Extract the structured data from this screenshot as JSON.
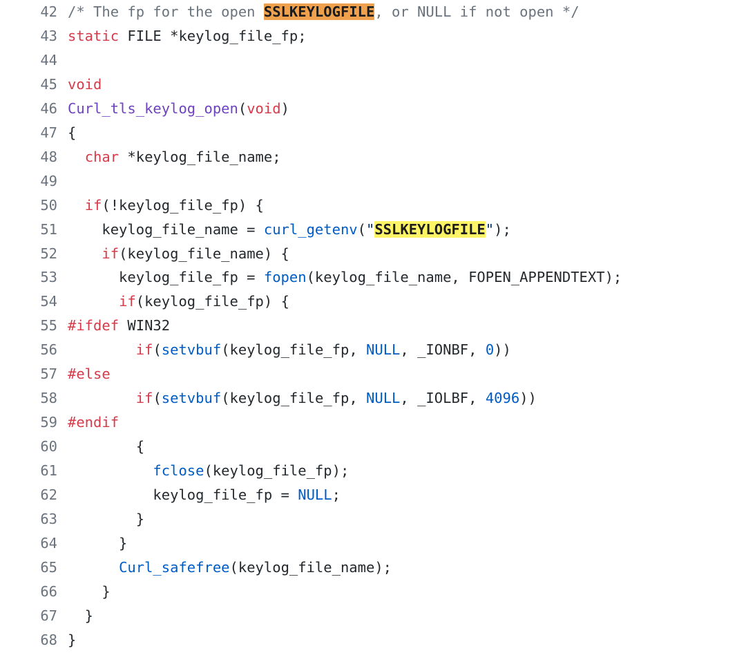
{
  "viewer": {
    "language": "C",
    "background_color": "#ffffff",
    "gutter_color": "#6a737d",
    "text_color": "#24292e",
    "first_line_number": 42,
    "last_line_number": 68,
    "total_lines_shown": 27
  },
  "theme": {
    "comment": "#6a737d",
    "keyword": "#d73a49",
    "function": "#005cc5",
    "definition": "#6f42c1",
    "string": "#032f62",
    "constant": "#005cc5",
    "number": "#005cc5",
    "preprocessor": "#d73a49",
    "plain": "#24292e",
    "highlight_current": "#efa14e",
    "highlight_match": "#fdf566"
  },
  "search": {
    "term": "SSLKEYLOGFILE",
    "current_match_line": 42,
    "other_match_lines": [
      51
    ]
  },
  "lines": [
    {
      "number": "42",
      "tokens": [
        {
          "t": "/* The fp for the open ",
          "c": "comment"
        },
        {
          "t": "SSLKEYLOGFILE",
          "c": "comment",
          "hl": "current"
        },
        {
          "t": ", or NULL if not open */",
          "c": "comment"
        }
      ]
    },
    {
      "number": "43",
      "tokens": [
        {
          "t": "static",
          "c": "keyword"
        },
        {
          "t": " FILE *keylog_file_fp;",
          "c": "plain"
        }
      ]
    },
    {
      "number": "44",
      "tokens": []
    },
    {
      "number": "45",
      "tokens": [
        {
          "t": "void",
          "c": "keyword"
        }
      ]
    },
    {
      "number": "46",
      "tokens": [
        {
          "t": "Curl_tls_keylog_open",
          "c": "definition"
        },
        {
          "t": "(",
          "c": "plain"
        },
        {
          "t": "void",
          "c": "keyword"
        },
        {
          "t": ")",
          "c": "plain"
        }
      ]
    },
    {
      "number": "47",
      "tokens": [
        {
          "t": "{",
          "c": "plain"
        }
      ]
    },
    {
      "number": "48",
      "tokens": [
        {
          "t": "  ",
          "c": "plain"
        },
        {
          "t": "char",
          "c": "keyword"
        },
        {
          "t": " *keylog_file_name;",
          "c": "plain"
        }
      ]
    },
    {
      "number": "49",
      "tokens": []
    },
    {
      "number": "50",
      "tokens": [
        {
          "t": "  ",
          "c": "plain"
        },
        {
          "t": "if",
          "c": "keyword"
        },
        {
          "t": "(!keylog_file_fp) {",
          "c": "plain"
        }
      ]
    },
    {
      "number": "51",
      "tokens": [
        {
          "t": "    keylog_file_name = ",
          "c": "plain"
        },
        {
          "t": "curl_getenv",
          "c": "function"
        },
        {
          "t": "(",
          "c": "plain"
        },
        {
          "t": "\"",
          "c": "string"
        },
        {
          "t": "SSLKEYLOGFILE",
          "c": "string",
          "hl": "match"
        },
        {
          "t": "\"",
          "c": "string"
        },
        {
          "t": ");",
          "c": "plain"
        }
      ]
    },
    {
      "number": "52",
      "tokens": [
        {
          "t": "    ",
          "c": "plain"
        },
        {
          "t": "if",
          "c": "keyword"
        },
        {
          "t": "(keylog_file_name) {",
          "c": "plain"
        }
      ]
    },
    {
      "number": "53",
      "tokens": [
        {
          "t": "      keylog_file_fp = ",
          "c": "plain"
        },
        {
          "t": "fopen",
          "c": "function"
        },
        {
          "t": "(keylog_file_name, FOPEN_APPENDTEXT);",
          "c": "plain"
        }
      ]
    },
    {
      "number": "54",
      "tokens": [
        {
          "t": "      ",
          "c": "plain"
        },
        {
          "t": "if",
          "c": "keyword"
        },
        {
          "t": "(keylog_file_fp) {",
          "c": "plain"
        }
      ]
    },
    {
      "number": "55",
      "tokens": [
        {
          "t": "#ifdef",
          "c": "preprocessor"
        },
        {
          "t": " WIN32",
          "c": "plain"
        }
      ]
    },
    {
      "number": "56",
      "tokens": [
        {
          "t": "        ",
          "c": "plain"
        },
        {
          "t": "if",
          "c": "keyword"
        },
        {
          "t": "(",
          "c": "plain"
        },
        {
          "t": "setvbuf",
          "c": "function"
        },
        {
          "t": "(keylog_file_fp, ",
          "c": "plain"
        },
        {
          "t": "NULL",
          "c": "constant"
        },
        {
          "t": ", _IONBF, ",
          "c": "plain"
        },
        {
          "t": "0",
          "c": "number"
        },
        {
          "t": "))",
          "c": "plain"
        }
      ]
    },
    {
      "number": "57",
      "tokens": [
        {
          "t": "#else",
          "c": "preprocessor"
        }
      ]
    },
    {
      "number": "58",
      "tokens": [
        {
          "t": "        ",
          "c": "plain"
        },
        {
          "t": "if",
          "c": "keyword"
        },
        {
          "t": "(",
          "c": "plain"
        },
        {
          "t": "setvbuf",
          "c": "function"
        },
        {
          "t": "(keylog_file_fp, ",
          "c": "plain"
        },
        {
          "t": "NULL",
          "c": "constant"
        },
        {
          "t": ", _IOLBF, ",
          "c": "plain"
        },
        {
          "t": "4096",
          "c": "number"
        },
        {
          "t": "))",
          "c": "plain"
        }
      ]
    },
    {
      "number": "59",
      "tokens": [
        {
          "t": "#endif",
          "c": "preprocessor"
        }
      ]
    },
    {
      "number": "60",
      "tokens": [
        {
          "t": "        {",
          "c": "plain"
        }
      ]
    },
    {
      "number": "61",
      "tokens": [
        {
          "t": "          ",
          "c": "plain"
        },
        {
          "t": "fclose",
          "c": "function"
        },
        {
          "t": "(keylog_file_fp);",
          "c": "plain"
        }
      ]
    },
    {
      "number": "62",
      "tokens": [
        {
          "t": "          keylog_file_fp = ",
          "c": "plain"
        },
        {
          "t": "NULL",
          "c": "constant"
        },
        {
          "t": ";",
          "c": "plain"
        }
      ]
    },
    {
      "number": "63",
      "tokens": [
        {
          "t": "        }",
          "c": "plain"
        }
      ]
    },
    {
      "number": "64",
      "tokens": [
        {
          "t": "      }",
          "c": "plain"
        }
      ]
    },
    {
      "number": "65",
      "tokens": [
        {
          "t": "      ",
          "c": "plain"
        },
        {
          "t": "Curl_safefree",
          "c": "function"
        },
        {
          "t": "(keylog_file_name);",
          "c": "plain"
        }
      ]
    },
    {
      "number": "66",
      "tokens": [
        {
          "t": "    }",
          "c": "plain"
        }
      ]
    },
    {
      "number": "67",
      "tokens": [
        {
          "t": "  }",
          "c": "plain"
        }
      ]
    },
    {
      "number": "68",
      "tokens": [
        {
          "t": "}",
          "c": "plain"
        }
      ]
    }
  ]
}
